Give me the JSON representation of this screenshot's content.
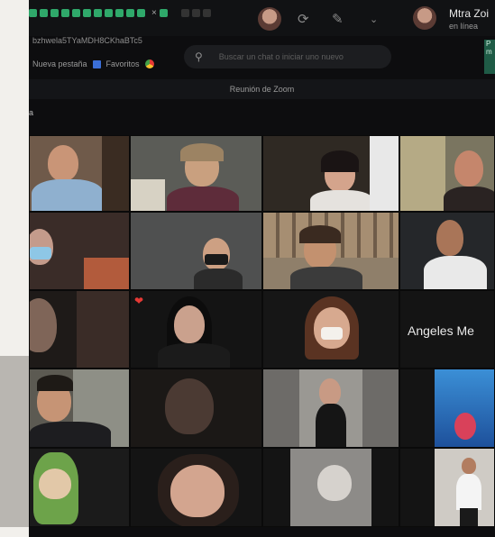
{
  "window": {
    "contact_name": "Mtra Zoi",
    "contact_status": "en línea",
    "url": "bzhwela5TYaMDH8CKhaBTc5",
    "bookmarks": [
      "Nueva pestaña",
      "Favoritos"
    ],
    "search_placeholder": "Buscar un chat o iniciar uno nuevo",
    "green_badge": "P\nm"
  },
  "meeting": {
    "title": "Reunión de Zoom",
    "side_label": "a"
  },
  "grid": {
    "name_tile": "Angeles Me"
  },
  "colors": {
    "background": "#0d0d0f",
    "accent_green": "#2fa86a"
  }
}
